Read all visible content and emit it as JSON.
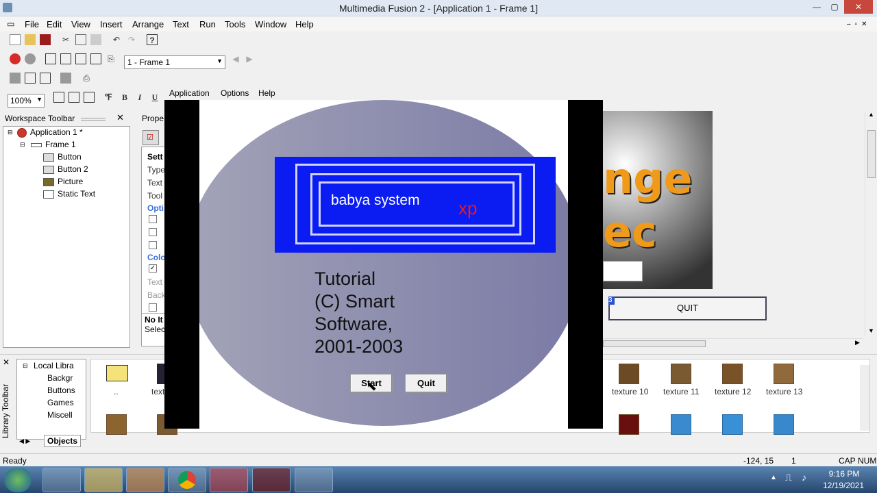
{
  "window": {
    "title": "Multimedia Fusion 2 - [Application 1 - Frame 1]",
    "min": "—",
    "max": "▢",
    "close": "✕"
  },
  "menu": [
    "File",
    "Edit",
    "View",
    "Insert",
    "Arrange",
    "Text",
    "Run",
    "Tools",
    "Window",
    "Help"
  ],
  "toolbar": {
    "frame_select": "1 - Frame 1",
    "zoom": "100%"
  },
  "workspace": {
    "title": "Workspace Toolbar",
    "items": [
      "Application 1 *",
      "Frame 1",
      "Button",
      "Button 2",
      "Picture",
      "Static Text"
    ]
  },
  "properties": {
    "title": "Prope",
    "rows": [
      "Sett",
      "Type",
      "Text",
      "Tool",
      "Opti",
      "",
      "",
      "",
      "Colo",
      "",
      "Text",
      "Back",
      "",
      "No It",
      "Selec"
    ]
  },
  "frame_editor": {
    "quit_label": "QUIT",
    "badge": "3",
    "title_text_a": "nge",
    "title_text_b": "ec"
  },
  "library": {
    "tree_title": "Local Libra",
    "tree_items": [
      "Backgr",
      "Buttons",
      "Games",
      "Miscell"
    ],
    "tab": "Objects",
    "vertical_label": "Library Toolbar",
    "items": [
      "..",
      "text",
      "texture 10",
      "texture 11",
      "texture 12",
      "texture 13"
    ]
  },
  "status": {
    "left": "Ready",
    "coords": "-124, 15",
    "num": "1",
    "cap": "CAP",
    "numlock": "NUM"
  },
  "taskbar": {
    "time": "9:16 PM",
    "date": "12/19/2021"
  },
  "app_preview": {
    "menu": [
      "Application",
      "Options",
      "Help"
    ],
    "banner_text": "babya system",
    "banner_xp": "xp",
    "body_lines": [
      "Tutorial",
      "(C) Smart",
      "Software,",
      "2001-2003"
    ],
    "start_label": "Start",
    "quit_label": "Quit"
  }
}
